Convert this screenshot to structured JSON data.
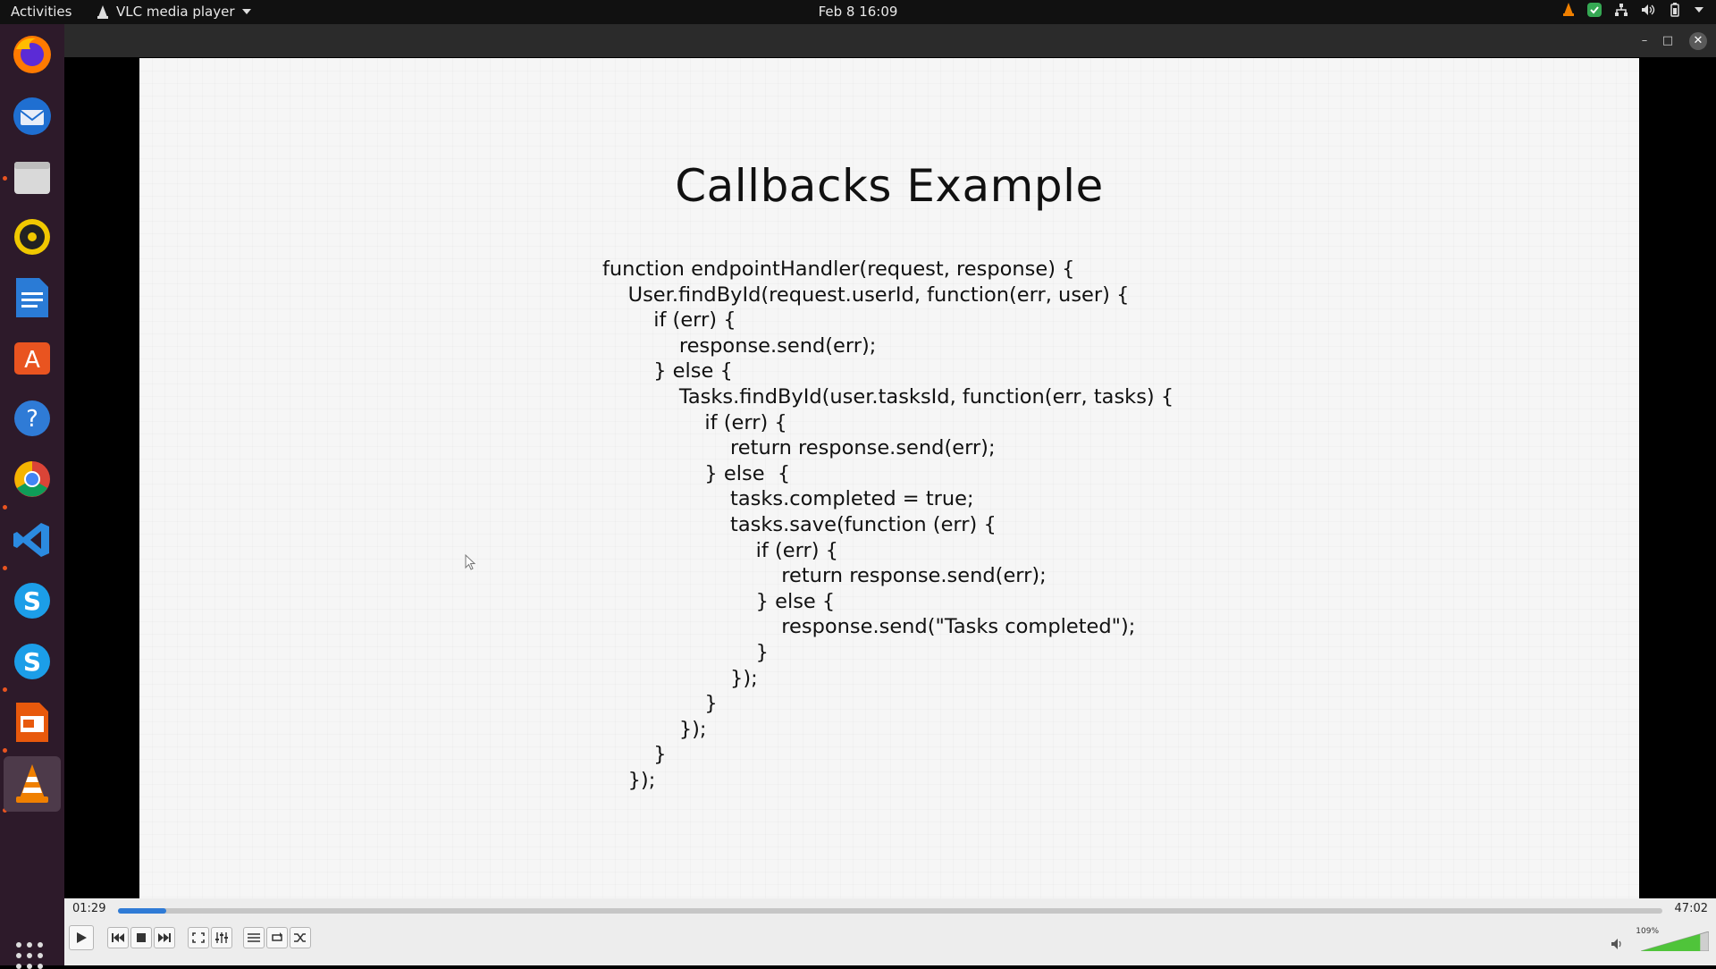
{
  "topbar": {
    "activities": "Activities",
    "app_name": "VLC media player",
    "clock": "Feb 8  16:09"
  },
  "dock": {
    "items": [
      {
        "name": "firefox-icon",
        "running": false
      },
      {
        "name": "thunderbird-icon",
        "running": false
      },
      {
        "name": "files-icon",
        "running": true
      },
      {
        "name": "rhythmbox-icon",
        "running": false
      },
      {
        "name": "libreoffice-writer-icon",
        "running": false
      },
      {
        "name": "ubuntu-software-icon",
        "running": false
      },
      {
        "name": "help-icon",
        "running": false
      },
      {
        "name": "chrome-icon",
        "running": true
      },
      {
        "name": "vscode-icon",
        "running": true
      },
      {
        "name": "skype-icon",
        "running": false
      },
      {
        "name": "skype-icon",
        "running": true
      },
      {
        "name": "libreoffice-impress-icon",
        "running": true
      },
      {
        "name": "vlc-icon",
        "running": true,
        "active": true
      }
    ]
  },
  "slide": {
    "title": "Callbacks Example",
    "code_lines": [
      "function endpointHandler(request, response) {",
      "    User.findById(request.userId, function(err, user) {",
      "        if (err) {",
      "            response.send(err);",
      "        } else {",
      "            Tasks.findById(user.tasksId, function(err, tasks) {",
      "                if (err) {",
      "                    return response.send(err);",
      "                } else  {",
      "                    tasks.completed = true;",
      "                    tasks.save(function (err) {",
      "                        if (err) {",
      "                            return response.send(err);",
      "                        } else {",
      "                            response.send(\"Tasks completed\");",
      "                        }",
      "                    });",
      "                }",
      "            });",
      "        }",
      "    });"
    ]
  },
  "player": {
    "time_current": "01:29",
    "time_total": "47:02",
    "progress": 0.031,
    "volume_label": "109%",
    "volume_level": 1.09
  },
  "colors": {
    "accent": "#2f7bd6",
    "ubuntu_orange": "#e95420",
    "dock_bg": "#2d1a2a"
  }
}
